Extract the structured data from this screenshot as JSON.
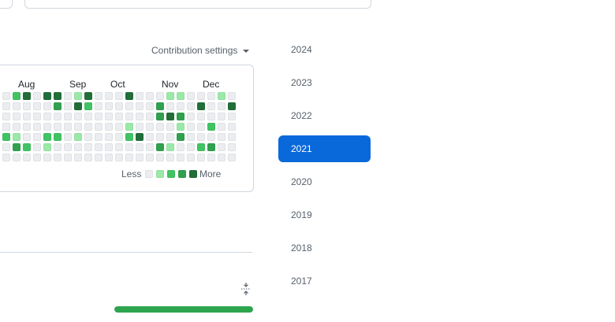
{
  "settings": {
    "label": "Contribution settings"
  },
  "graph": {
    "months": [
      "Aug",
      "Sep",
      "Oct",
      "Nov",
      "Dec"
    ],
    "levels": [
      [
        0,
        0,
        0,
        0,
        0,
        0,
        0
      ],
      [
        0,
        0,
        0,
        0,
        2,
        0,
        0
      ],
      [
        2,
        0,
        0,
        0,
        1,
        3,
        0
      ],
      [
        4,
        0,
        0,
        0,
        0,
        2,
        0
      ],
      [
        0,
        0,
        0,
        0,
        0,
        0,
        0
      ],
      [
        4,
        0,
        0,
        0,
        2,
        1,
        0
      ],
      [
        4,
        3,
        0,
        0,
        2,
        0,
        0
      ],
      [
        0,
        0,
        0,
        0,
        0,
        0,
        0
      ],
      [
        1,
        4,
        0,
        0,
        1,
        0,
        0
      ],
      [
        4,
        2,
        0,
        0,
        0,
        0,
        0
      ],
      [
        0,
        0,
        0,
        0,
        0,
        0,
        0
      ],
      [
        0,
        0,
        0,
        0,
        0,
        0,
        0
      ],
      [
        0,
        0,
        0,
        0,
        0,
        0,
        0
      ],
      [
        4,
        0,
        0,
        1,
        2,
        0,
        0
      ],
      [
        0,
        0,
        0,
        0,
        4,
        0,
        0
      ],
      [
        0,
        0,
        0,
        0,
        0,
        0,
        0
      ],
      [
        0,
        3,
        3,
        0,
        0,
        3,
        0
      ],
      [
        1,
        0,
        4,
        0,
        0,
        1,
        0
      ],
      [
        1,
        0,
        3,
        1,
        3,
        0,
        0
      ],
      [
        0,
        0,
        0,
        0,
        0,
        0,
        0
      ],
      [
        0,
        4,
        0,
        0,
        0,
        2,
        0
      ],
      [
        0,
        0,
        0,
        2,
        0,
        3,
        0
      ],
      [
        1,
        0,
        0,
        0,
        0,
        0,
        0
      ],
      [
        0,
        4,
        0,
        0,
        0,
        0,
        0
      ]
    ],
    "legend": {
      "less": "Less",
      "more": "More"
    },
    "colors": [
      "#ebedf0",
      "#9be9a8",
      "#40c463",
      "#30a14e",
      "#216e39"
    ]
  },
  "progress": {
    "fraction": 1.0,
    "color": "#2da44e"
  },
  "years": {
    "items": [
      "2024",
      "2023",
      "2022",
      "2021",
      "2020",
      "2019",
      "2018",
      "2017"
    ],
    "selected": "2021",
    "accent": "#0969da"
  },
  "icons": {
    "fold": "fold-icon"
  }
}
